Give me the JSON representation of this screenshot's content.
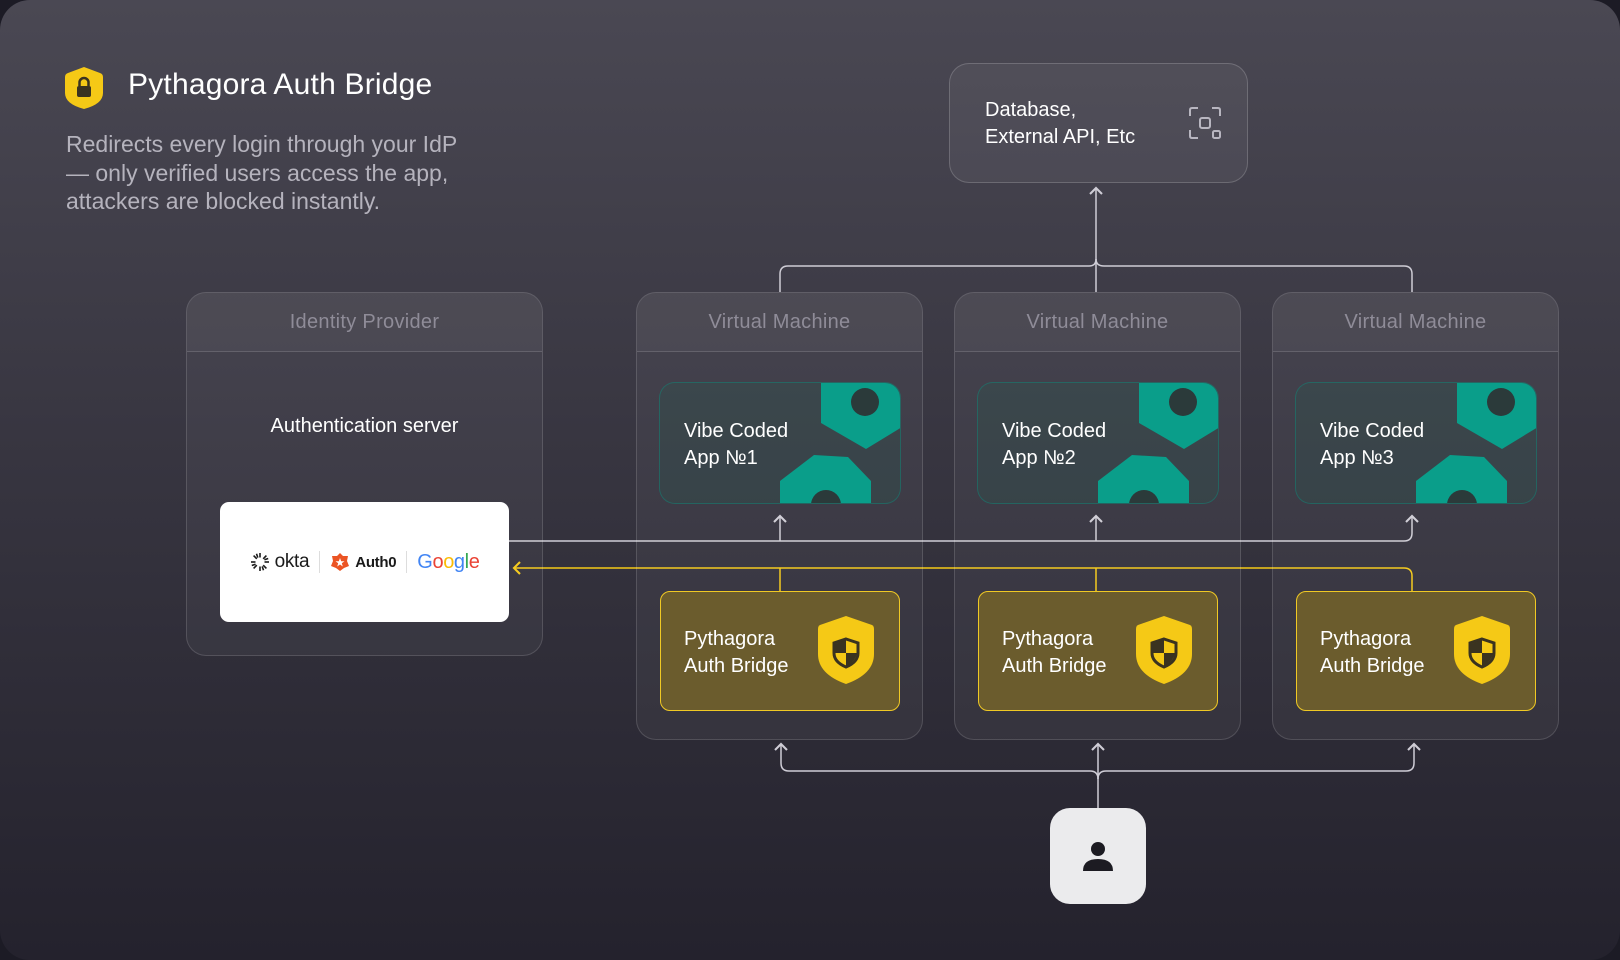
{
  "title": "Pythagora Auth Bridge",
  "description": "Redirects every login through your IdP — only verified users access the app, attackers are blocked instantly.",
  "identity_provider": {
    "header": "Identity Provider",
    "server_label": "Authentication server",
    "providers": [
      "okta",
      "Auth0",
      "Google"
    ]
  },
  "database": {
    "label": "Database,\nExternal API, Etc",
    "icon": "scan-icon"
  },
  "machines": [
    {
      "header": "Virtual Machine",
      "app": "Vibe Coded\nApp №1",
      "bridge": "Pythagora\nAuth Bridge"
    },
    {
      "header": "Virtual Machine",
      "app": "Vibe Coded\nApp №2",
      "bridge": "Pythagora\nAuth Bridge"
    },
    {
      "header": "Virtual Machine",
      "app": "Vibe Coded\nApp №3",
      "bridge": "Pythagora\nAuth Bridge"
    }
  ],
  "user_icon": "user-icon",
  "colors": {
    "accent_yellow": "#f5c916",
    "bridge_fill": "#6b5c2d",
    "app_teal": "#0a9e8a",
    "connector": "#cfcdd6"
  }
}
